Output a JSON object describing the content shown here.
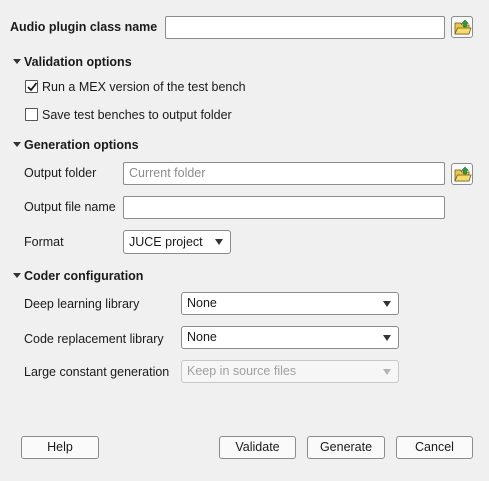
{
  "plugin_class": {
    "label": "Audio plugin class name",
    "value": "",
    "browse_icon": "folder-open-icon"
  },
  "validation": {
    "heading": "Validation options",
    "options": [
      {
        "label": "Run a MEX version of the test bench",
        "checked": true
      },
      {
        "label": "Save test benches to output folder",
        "checked": false
      }
    ]
  },
  "generation": {
    "heading": "Generation options",
    "output_folder": {
      "label": "Output folder",
      "placeholder": "Current folder",
      "value": ""
    },
    "output_file": {
      "label": "Output file name",
      "value": ""
    },
    "format": {
      "label": "Format",
      "value": "JUCE project"
    }
  },
  "coder": {
    "heading": "Coder configuration",
    "deep_learning": {
      "label": "Deep learning library",
      "value": "None"
    },
    "code_replacement": {
      "label": "Code replacement library",
      "value": "None"
    },
    "large_constant": {
      "label": "Large constant generation",
      "value": "Keep in source files",
      "disabled": true
    }
  },
  "buttons": {
    "help": "Help",
    "validate": "Validate",
    "generate": "Generate",
    "cancel": "Cancel"
  },
  "colors": {
    "background": "#f0f0f0",
    "folder_icon": "#e8c84a",
    "folder_arrow": "#2e9b3a"
  }
}
